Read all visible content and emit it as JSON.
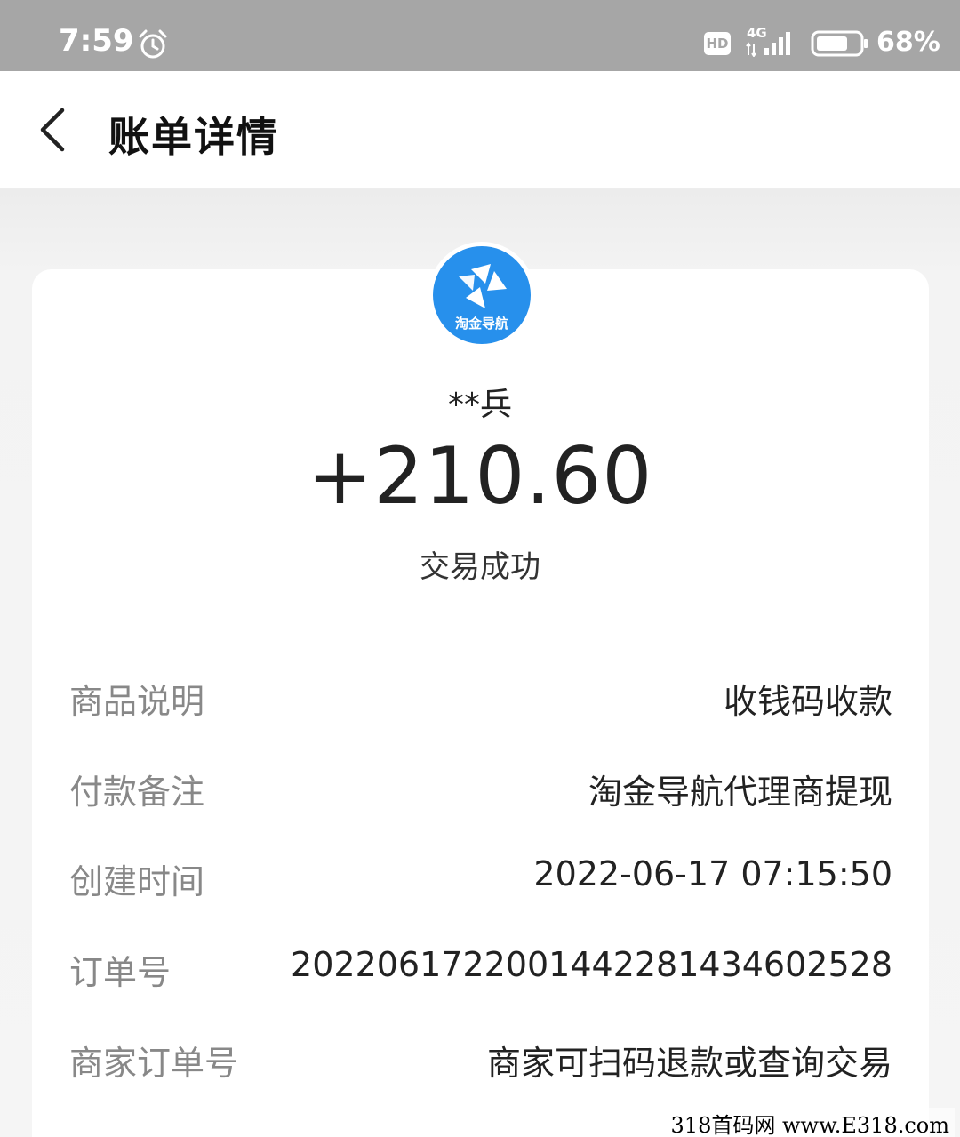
{
  "status_bar": {
    "time": "7:59",
    "hd": "HD",
    "network": "4G",
    "battery": "68%"
  },
  "header": {
    "title": "账单详情"
  },
  "transaction": {
    "merchant_logo_text": "淘金导航",
    "payer": "**兵",
    "amount": "+210.60",
    "status": "交易成功"
  },
  "details": [
    {
      "label": "商品说明",
      "value": "收钱码收款"
    },
    {
      "label": "付款备注",
      "value": "淘金导航代理商提现"
    },
    {
      "label": "创建时间",
      "value": "2022-06-17 07:15:50"
    },
    {
      "label": "订单号",
      "value": "2022061722001442281434602528"
    },
    {
      "label": "商家订单号",
      "value": "商家可扫码退款或查询交易"
    }
  ],
  "watermark": "318首码网 www.E318.com"
}
